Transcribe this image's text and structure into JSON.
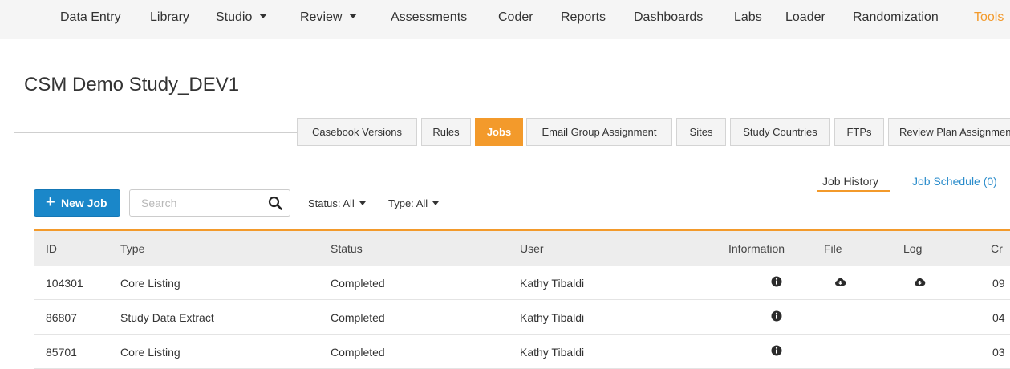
{
  "nav": {
    "items": [
      {
        "label": "Data Entry"
      },
      {
        "label": "Library"
      },
      {
        "label": "Studio"
      },
      {
        "label": "Review"
      },
      {
        "label": "Assessments"
      },
      {
        "label": "Coder"
      },
      {
        "label": "Reports"
      },
      {
        "label": "Dashboards"
      },
      {
        "label": "Labs"
      },
      {
        "label": "Loader"
      },
      {
        "label": "Randomization"
      },
      {
        "label": "Tools"
      }
    ],
    "active": "Tools",
    "accent_color": "#f39a2b"
  },
  "page": {
    "title": "CSM Demo Study_DEV1"
  },
  "tabs": [
    {
      "label": "Casebook Versions"
    },
    {
      "label": "Rules"
    },
    {
      "label": "Jobs"
    },
    {
      "label": "Email Group Assignment"
    },
    {
      "label": "Sites"
    },
    {
      "label": "Study Countries"
    },
    {
      "label": "FTPs"
    },
    {
      "label": "Review Plan Assignment"
    }
  ],
  "active_tab": "Jobs",
  "history": {
    "job_history": "Job History",
    "job_schedule": "Job Schedule (0)"
  },
  "toolbar": {
    "new_job_icon": "plus-icon",
    "new_job": "New Job",
    "search_placeholder": "Search",
    "search_value": "",
    "search_icon": "search-icon",
    "status_filter": "Status: All",
    "type_filter": "Type: All",
    "button_color": "#1a87c9"
  },
  "table": {
    "columns": [
      "ID",
      "Type",
      "Status",
      "User",
      "Information",
      "File",
      "Log",
      "Cr"
    ],
    "rows": [
      {
        "id": "104301",
        "type": "Core Listing",
        "status": "Completed",
        "user": "Kathy Tibaldi",
        "info_icon": "info-icon",
        "file_icon": "cloud-download-icon",
        "log_icon": "cloud-download-icon",
        "created": "09"
      },
      {
        "id": "86807",
        "type": "Study Data Extract",
        "status": "Completed",
        "user": "Kathy Tibaldi",
        "info_icon": "info-icon",
        "created": "04"
      },
      {
        "id": "85701",
        "type": "Core Listing",
        "status": "Completed",
        "user": "Kathy Tibaldi",
        "info_icon": "info-icon",
        "created": "03"
      }
    ]
  }
}
